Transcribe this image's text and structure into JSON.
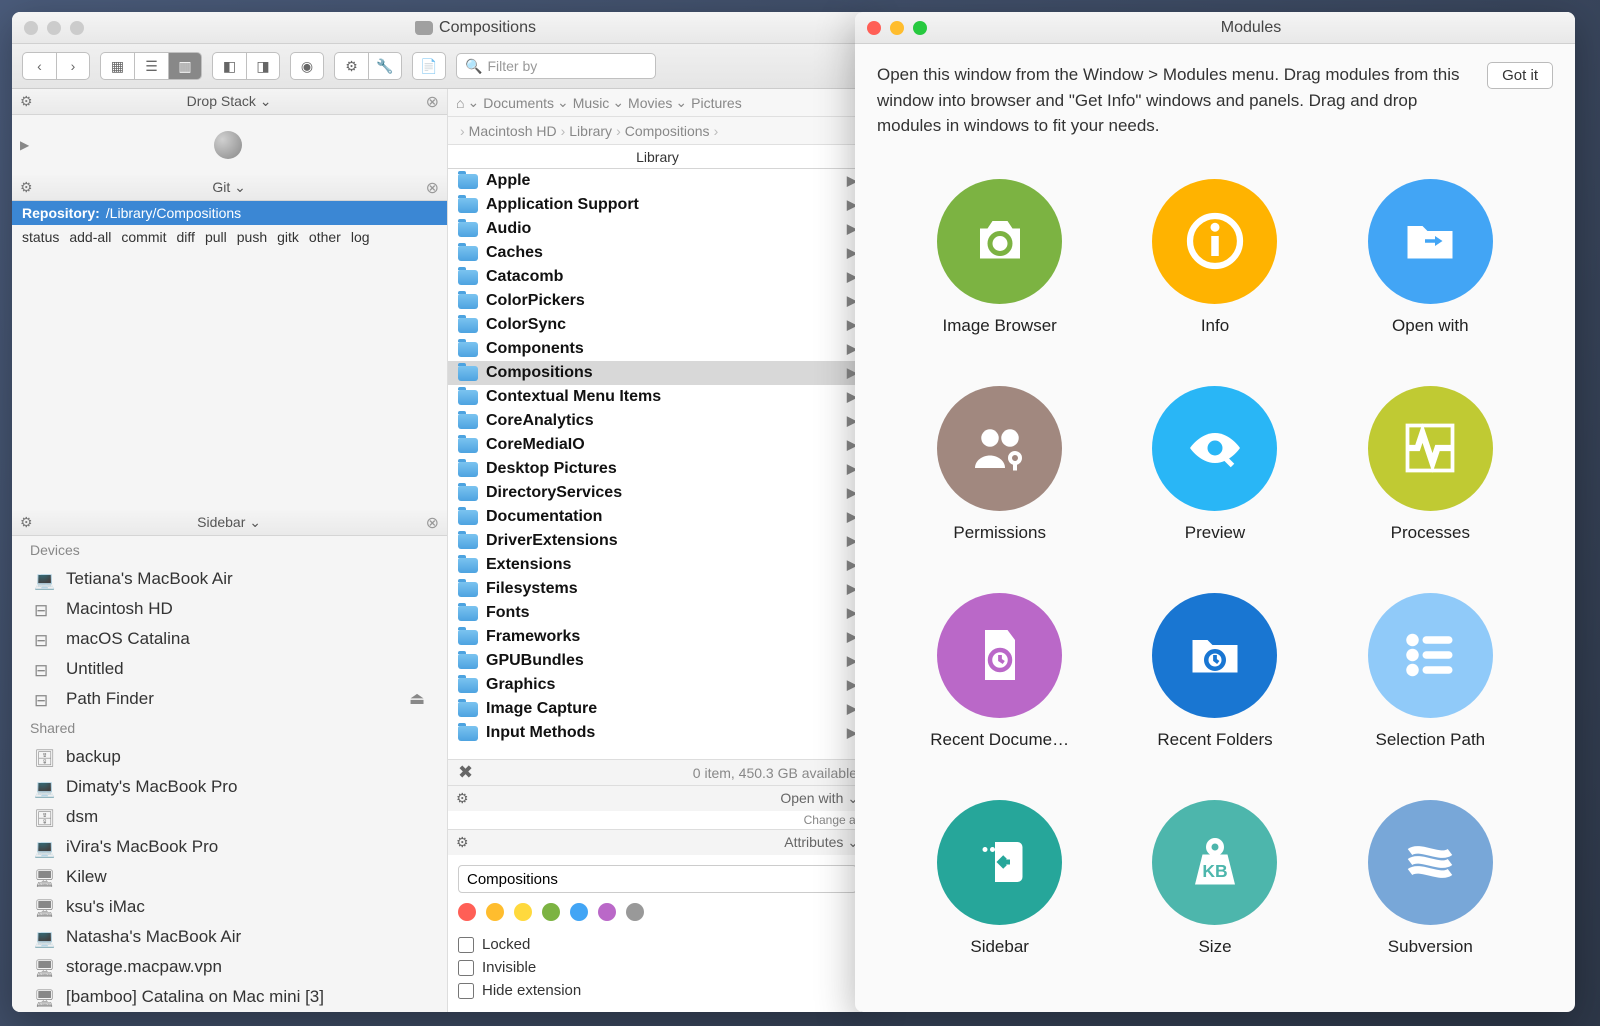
{
  "finder": {
    "title": "Compositions",
    "toolbar": {
      "search_placeholder": "Filter by"
    },
    "tabbar": {
      "home": "Home",
      "documents": "Documents",
      "music": "Music",
      "movies": "Movies",
      "pictures": "Pictures"
    },
    "pathbar": [
      "Macintosh HD",
      "Library",
      "Compositions"
    ],
    "drop_stack": {
      "title": "Drop Stack"
    },
    "git": {
      "title": "Git",
      "repo_label": "Repository:",
      "repo_path": "/Library/Compositions",
      "commands": [
        "status",
        "add-all",
        "commit",
        "diff",
        "pull",
        "push",
        "gitk",
        "other",
        "log"
      ]
    },
    "sidebar": {
      "title": "Sidebar",
      "sections": [
        {
          "heading": "Devices",
          "items": [
            {
              "label": "Tetiana's MacBook Air",
              "icon": "laptop"
            },
            {
              "label": "Macintosh HD",
              "icon": "disk"
            },
            {
              "label": "macOS Catalina",
              "icon": "disk"
            },
            {
              "label": "Untitled",
              "icon": "disk"
            },
            {
              "label": "Path Finder",
              "icon": "disk",
              "eject": true
            }
          ]
        },
        {
          "heading": "Shared",
          "items": [
            {
              "label": "backup",
              "icon": "server"
            },
            {
              "label": "Dimaty's MacBook Pro",
              "icon": "laptop"
            },
            {
              "label": "dsm",
              "icon": "server"
            },
            {
              "label": "iVira's MacBook Pro",
              "icon": "laptop"
            },
            {
              "label": "Kilew",
              "icon": "display"
            },
            {
              "label": "ksu's iMac",
              "icon": "display"
            },
            {
              "label": "Natasha's MacBook Air",
              "icon": "laptop"
            },
            {
              "label": "storage.macpaw.vpn",
              "icon": "display"
            },
            {
              "label": "[bamboo] Catalina on Mac mini [3]",
              "icon": "display"
            }
          ]
        }
      ]
    },
    "column_header": "Library",
    "folders": [
      "Apple",
      "Application Support",
      "Audio",
      "Caches",
      "Catacomb",
      "ColorPickers",
      "ColorSync",
      "Components",
      "Compositions",
      "Contextual Menu Items",
      "CoreAnalytics",
      "CoreMediaIO",
      "Desktop Pictures",
      "DirectoryServices",
      "Documentation",
      "DriverExtensions",
      "Extensions",
      "Filesystems",
      "Fonts",
      "Frameworks",
      "GPUBundles",
      "Graphics",
      "Image Capture",
      "Input Methods"
    ],
    "selected_folder": "Compositions",
    "status": "0 item, 450.3 GB available",
    "openwith": {
      "title": "Open with",
      "change_all": "Change all"
    },
    "attributes": {
      "title": "Attributes",
      "name_value": "Compositions",
      "colors": [
        "#ff5f56",
        "#ffbd2e",
        "#ffd93d",
        "#7cb342",
        "#42a5f5",
        "#ba68c8",
        "#999"
      ],
      "checks": [
        "Locked",
        "Invisible",
        "Hide extension"
      ]
    }
  },
  "modules": {
    "title": "Modules",
    "intro": "Open this window from the Window > Modules menu. Drag modules from this window into browser and \"Get Info\" windows and panels. Drag and drop modules in windows to fit your needs.",
    "got_it": "Got it",
    "items": [
      {
        "label": "Image Browser",
        "color": "c-green",
        "icon": "camera"
      },
      {
        "label": "Info",
        "color": "c-orange",
        "icon": "info"
      },
      {
        "label": "Open with",
        "color": "c-blue",
        "icon": "folder-arrow"
      },
      {
        "label": "Permissions",
        "color": "c-brown",
        "icon": "users-key"
      },
      {
        "label": "Preview",
        "color": "c-cyan",
        "icon": "eye"
      },
      {
        "label": "Processes",
        "color": "c-lime",
        "icon": "activity"
      },
      {
        "label": "Recent Docume…",
        "color": "c-purple",
        "icon": "doc-clock"
      },
      {
        "label": "Recent Folders",
        "color": "c-darkblue",
        "icon": "folder-clock"
      },
      {
        "label": "Selection Path",
        "color": "c-lightblue",
        "icon": "path"
      },
      {
        "label": "Sidebar",
        "color": "c-teal",
        "icon": "sidebar"
      },
      {
        "label": "Size",
        "color": "c-teal2",
        "icon": "weight"
      },
      {
        "label": "Subversion",
        "color": "c-bluegrey",
        "icon": "svn"
      }
    ]
  }
}
